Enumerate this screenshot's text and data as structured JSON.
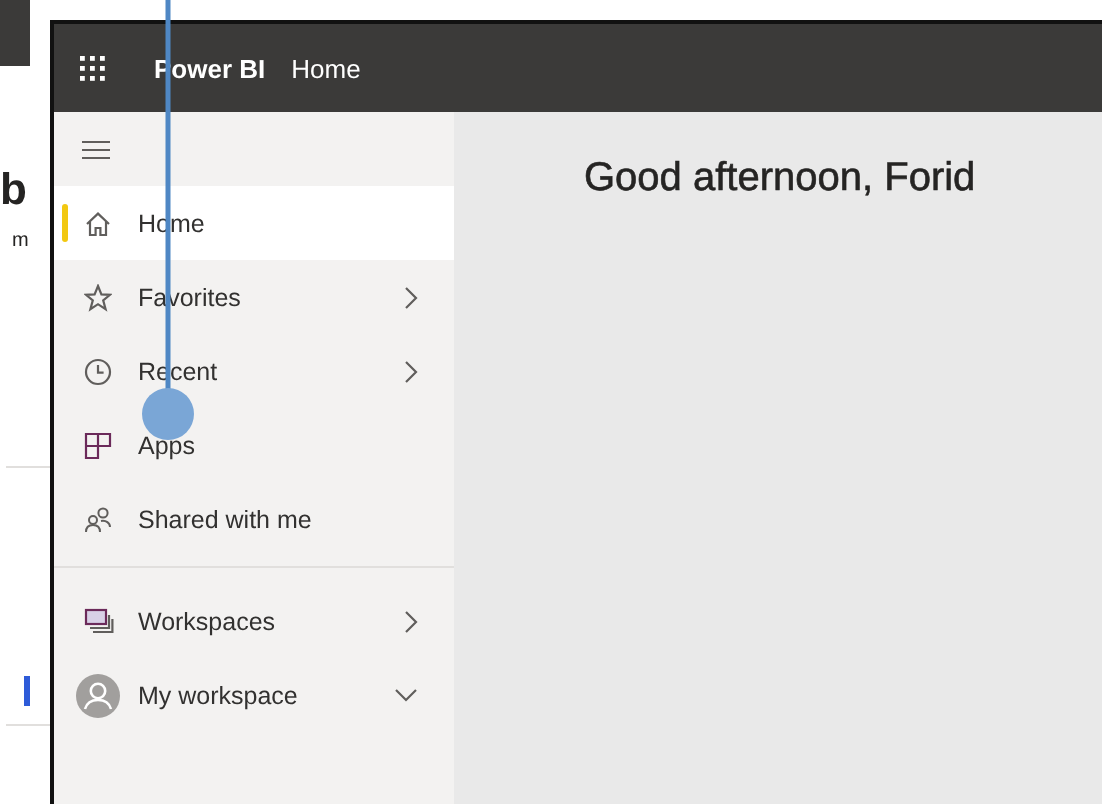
{
  "background_page": {
    "fragments": [
      "b",
      "m"
    ]
  },
  "header": {
    "app_name": "Power BI",
    "breadcrumb": "Home"
  },
  "sidebar": {
    "sections": [
      {
        "items": [
          {
            "label": "Home",
            "selected": true,
            "kind": "link"
          },
          {
            "label": "Favorites",
            "selected": false,
            "kind": "flyout"
          },
          {
            "label": "Recent",
            "selected": false,
            "kind": "flyout"
          },
          {
            "label": "Apps",
            "selected": false,
            "kind": "link"
          },
          {
            "label": "Shared with me",
            "selected": false,
            "kind": "link"
          }
        ]
      },
      {
        "items": [
          {
            "label": "Workspaces",
            "selected": false,
            "kind": "flyout"
          },
          {
            "label": "My workspace",
            "selected": false,
            "kind": "collapsible"
          }
        ]
      }
    ]
  },
  "main": {
    "greeting": "Good afternoon, Forid"
  }
}
